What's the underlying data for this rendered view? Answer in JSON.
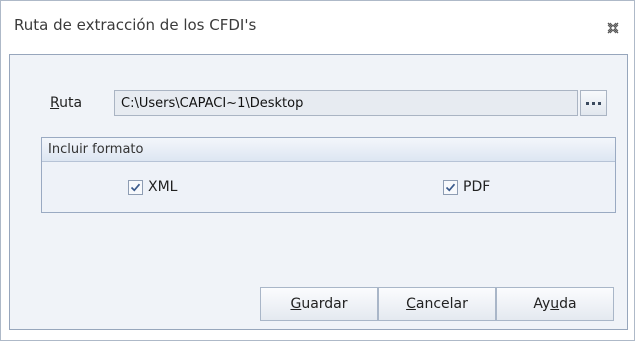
{
  "window": {
    "title": "Ruta de extracción de los CFDI's",
    "close_icon": "close-icon"
  },
  "ruta": {
    "label_mnemonic": "R",
    "label_rest": "uta",
    "value": "C:\\Users\\CAPACI~1\\Desktop",
    "browse_icon": "ellipsis-icon"
  },
  "formato": {
    "title": "Incluir formato",
    "options": [
      {
        "label": "XML",
        "checked": true
      },
      {
        "label": "PDF",
        "checked": true
      }
    ]
  },
  "buttons": {
    "guardar": {
      "mnemonic": "G",
      "rest": "uardar"
    },
    "cancelar": {
      "mnemonic": "C",
      "rest": "ancelar"
    },
    "ayuda": {
      "before": "Ay",
      "mnemonic": "u",
      "rest": "da"
    }
  },
  "colors": {
    "panel_bg": "#f0f3f8",
    "border": "#97a6bc",
    "check_mark": "#3a5a8c"
  }
}
